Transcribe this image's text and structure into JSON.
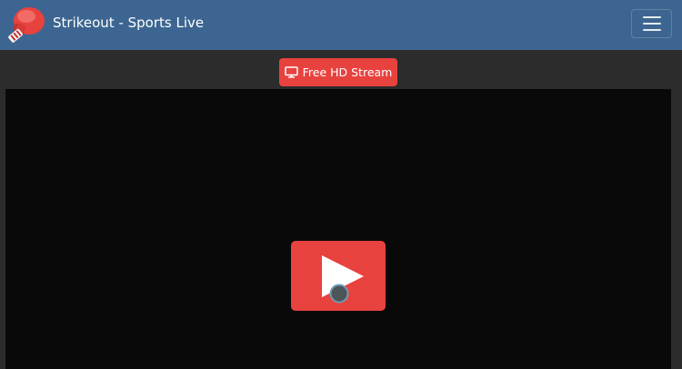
{
  "header": {
    "brand": "Strikeout - Sports Live",
    "logo_icon": "boxing-glove-icon",
    "menu_icon": "hamburger-menu-icon",
    "bg_color": "#3c6691"
  },
  "stream": {
    "button_label": "Free HD Stream",
    "button_icon": "monitor-icon",
    "accent_color": "#e8423f"
  },
  "player": {
    "play_icon": "play-icon",
    "loading_icon": "loading-spinner-icon",
    "bg_color": "#090909"
  }
}
